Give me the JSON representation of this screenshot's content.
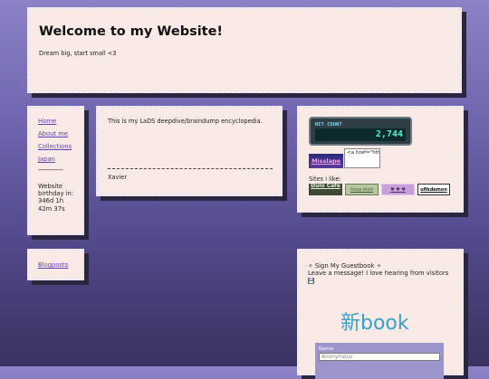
{
  "header": {
    "title": "Welcome to my Website!",
    "tagline": "Dream big, start small <3"
  },
  "nav": {
    "items": [
      {
        "label": "Home"
      },
      {
        "label": "About me"
      },
      {
        "label": "Collections"
      },
      {
        "label": "Japan"
      }
    ],
    "separator": "--------------",
    "birthday": "Website birthday in: 346d 1h 42m 37s"
  },
  "nav2": {
    "link": "Blogposts"
  },
  "main": {
    "intro": "This is my LaDS deepdive/braindump encyclopedia.",
    "signature": "Xavier"
  },
  "sidebar": {
    "hit_counter": {
      "label": "HIT COUNT",
      "value": "2,744"
    },
    "misslapel_button": "Misslape",
    "code_snippet": "<a href=\"https://misstalp",
    "sites_label": "Sites i like:",
    "sites": [
      {
        "label": "Dulo Café"
      },
      {
        "label": "linux mint"
      },
      {
        "label": "♥ ♥ ♥"
      },
      {
        "label": "ufikdemon"
      }
    ]
  },
  "guestbook": {
    "title": "✧ Sign My Guestbook ✧",
    "message": "Leave a message! I love hearing from visitors",
    "logo_text": "新book",
    "name_label": "Name:",
    "name_placeholder": "Anonymous"
  },
  "colors": {
    "background_top": "#8b82c7",
    "background_bottom": "#3a325f",
    "panel": "#faeae6",
    "link": "#5b3fb0",
    "guestbook_logo": "#3aa0c8",
    "form_bg": "#9c95cc"
  }
}
